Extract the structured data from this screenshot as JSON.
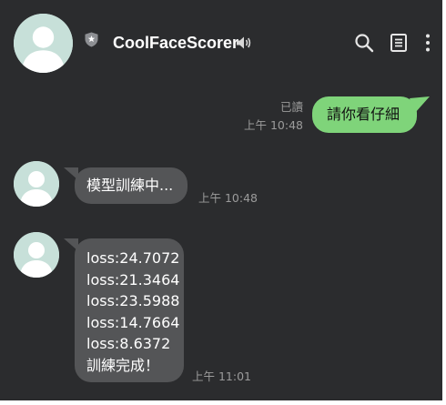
{
  "header": {
    "title": "CoolFaceScorer"
  },
  "messages": {
    "outgoing": {
      "text": "請你看仔細",
      "read_label": "已讀",
      "time": "上午 10:48"
    },
    "incoming1": {
      "text": "模型訓練中...",
      "time": "上午 10:48"
    },
    "incoming2": {
      "lines": [
        "loss:24.7072",
        "loss:21.3464",
        "loss:23.5988",
        "loss:14.7664",
        "loss:8.6372",
        "訓練完成！"
      ],
      "time": "上午 11:01"
    }
  },
  "icons": {
    "shield": "shield-star-icon",
    "speaker": "speaker-icon",
    "search": "search-icon",
    "notes": "notes-icon",
    "more": "more-vertical-icon",
    "avatar": "default-avatar-icon"
  },
  "colors": {
    "background": "#2b2c2e",
    "outgoing_bubble": "#7fd47a",
    "incoming_bubble": "#545557",
    "avatar_bg": "#c7e0d9",
    "meta_text": "#9b9b9b"
  }
}
